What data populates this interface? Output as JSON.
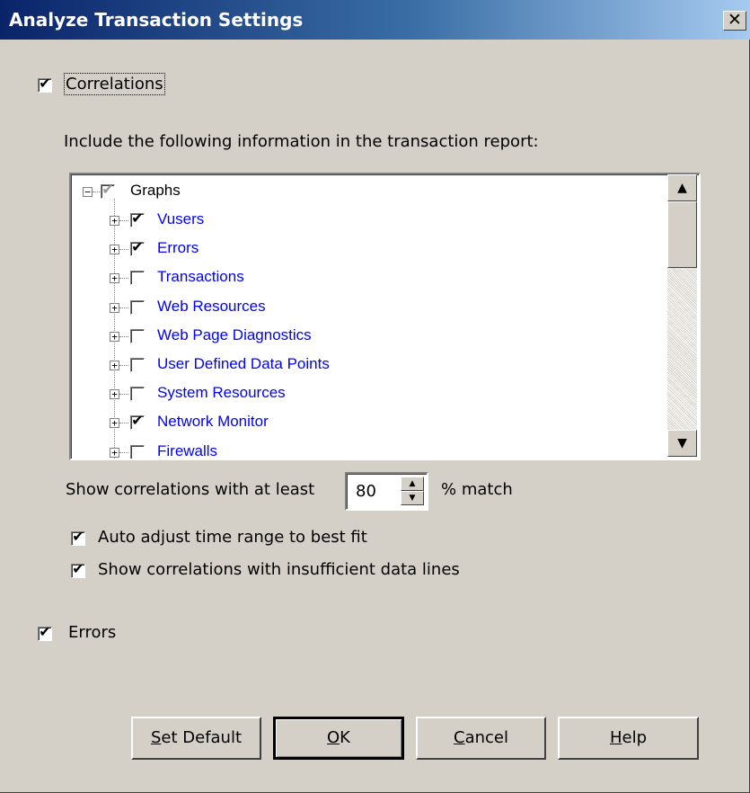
{
  "window": {
    "title": "Analyze Transaction Settings",
    "close_glyph": "✕"
  },
  "correlations": {
    "label": "Correlations",
    "checked": true
  },
  "include_text": "Include the following information in the transaction report:",
  "tree": {
    "root": {
      "label": "Graphs",
      "checked": true,
      "grayed": true
    },
    "items": [
      {
        "label": "Vusers",
        "checked": true
      },
      {
        "label": "Errors",
        "checked": true
      },
      {
        "label": "Transactions",
        "checked": false
      },
      {
        "label": "Web Resources",
        "checked": false
      },
      {
        "label": "Web Page Diagnostics",
        "checked": false
      },
      {
        "label": "User Defined Data Points",
        "checked": false
      },
      {
        "label": "System Resources",
        "checked": false
      },
      {
        "label": "Network Monitor",
        "checked": true
      },
      {
        "label": "Firewalls",
        "checked": false
      }
    ]
  },
  "show_corr": {
    "prefix": "Show correlations with at least",
    "value": "80",
    "suffix": "% match"
  },
  "auto_adjust": {
    "label": "Auto adjust time range to best fit",
    "checked": true
  },
  "insufficient": {
    "label": "Show correlations with insufficient data lines",
    "checked": true
  },
  "errors": {
    "label": "Errors",
    "checked": true
  },
  "buttons": {
    "set_default": {
      "pre": "",
      "key": "S",
      "post": "et Default"
    },
    "ok": {
      "pre": "",
      "key": "O",
      "post": "K"
    },
    "cancel": {
      "pre": "",
      "key": "C",
      "post": "ancel"
    },
    "help": {
      "pre": "",
      "key": "H",
      "post": "elp"
    }
  },
  "icons": {
    "check": "check-icon",
    "up": "arrow-up-icon",
    "down": "arrow-down-icon",
    "expand": "plus-expand-icon",
    "collapse": "minus-collapse-icon"
  }
}
